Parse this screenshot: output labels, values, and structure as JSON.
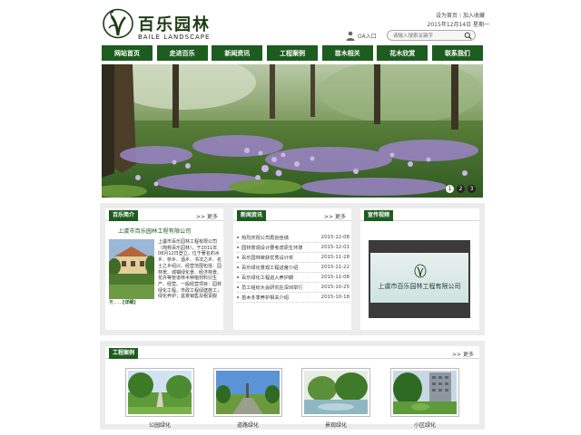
{
  "brand": {
    "name_cn": "百乐园林",
    "name_en": "BAILE LANDSCAPE"
  },
  "top": {
    "set_home": "设为首页",
    "add_fav": "加入收藏",
    "date": "2015年12月14日 星期一",
    "oa_label": "OA入口",
    "search_placeholder": "请输入搜索关键字"
  },
  "nav": [
    {
      "label": "网站首页"
    },
    {
      "label": "走进百乐"
    },
    {
      "label": "新闻资讯"
    },
    {
      "label": "工程案例"
    },
    {
      "label": "苗木相关"
    },
    {
      "label": "花木欣赏"
    },
    {
      "label": "联系我们"
    }
  ],
  "banner": {
    "dots": [
      "1",
      "2",
      "3"
    ],
    "active_dot": 0
  },
  "intro": {
    "tag": "百乐简介",
    "more": ">> 更多",
    "company": "上虞市百乐园林工程有限公司",
    "text": "上虞市百乐园林工程有限公司（简称百乐园林），于2011年08月12日登立。位于著名的水乡、桥乡、酒乡、书法之乡、名士之乡绍兴。经营范围包括：园林景、城镇绿化景、经济林景、花卉等管道林木种植材料衍生产、经营。一般经营项目：园林绿化工程，市政工程绿建施工；绿化养护；盆景销售及租赁服务……",
    "detail": "[详细]"
  },
  "news": {
    "tag": "新闻资讯",
    "more": ">> 更多",
    "items": [
      {
        "title": "热烈庆祝公司再创佳绩",
        "date": "2015-12-08"
      },
      {
        "title": "园林景观设计要考虑原生环境",
        "date": "2015-12-01"
      },
      {
        "title": "百乐园林荣获优秀设计奖",
        "date": "2015-11-28"
      },
      {
        "title": "百乐绿化景观工程进度介绍",
        "date": "2015-11-22"
      },
      {
        "title": "百乐绿化工程进入养护期",
        "date": "2015-11-08"
      },
      {
        "title": "员工组织大会研究在深圳举行",
        "date": "2015-10-25"
      },
      {
        "title": "苗木冬季养护相关介绍",
        "date": "2015-10-18"
      }
    ]
  },
  "video": {
    "tag": "宣传视频",
    "title": "上虞市百乐园林工程有限公司"
  },
  "projects": {
    "tag": "工程案例",
    "more": ">> 更多",
    "items": [
      {
        "label": "公园绿化"
      },
      {
        "label": "道路绿化"
      },
      {
        "label": "景观绿化"
      },
      {
        "label": "小区绿化"
      }
    ]
  },
  "colors": {
    "brand_green": "#1d5c1f"
  }
}
